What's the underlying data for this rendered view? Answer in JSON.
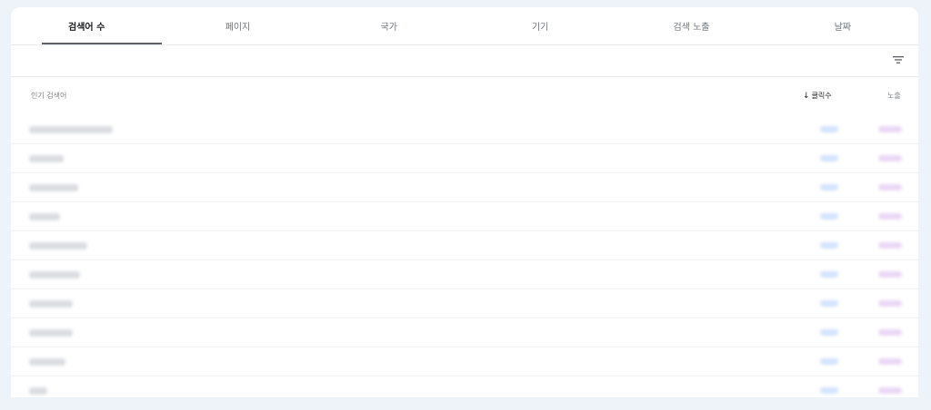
{
  "tabs": [
    {
      "label": "검색어 수",
      "active": true
    },
    {
      "label": "페이지",
      "active": false
    },
    {
      "label": "국가",
      "active": false
    },
    {
      "label": "기기",
      "active": false
    },
    {
      "label": "검색 노출",
      "active": false
    },
    {
      "label": "날짜",
      "active": false
    }
  ],
  "table": {
    "query_header": "인기 검색어",
    "clicks_header": "클릭수",
    "impressions_header": "노출",
    "sort_icon": "arrow-down-icon",
    "filter_icon": "filter-icon",
    "rows": [
      {
        "query": "",
        "clicks": "",
        "impressions": ""
      },
      {
        "query": "",
        "clicks": "",
        "impressions": ""
      },
      {
        "query": "",
        "clicks": "",
        "impressions": ""
      },
      {
        "query": "",
        "clicks": "",
        "impressions": ""
      },
      {
        "query": "",
        "clicks": "",
        "impressions": ""
      },
      {
        "query": "",
        "clicks": "",
        "impressions": ""
      },
      {
        "query": "",
        "clicks": "",
        "impressions": ""
      },
      {
        "query": "",
        "clicks": "",
        "impressions": ""
      },
      {
        "query": "",
        "clicks": "",
        "impressions": ""
      },
      {
        "query": "",
        "clicks": "",
        "impressions": ""
      }
    ]
  },
  "colors": {
    "background": "#eef2f9",
    "card": "#ffffff",
    "clicks_accent": "#4285f4",
    "impressions_accent": "#a142f4"
  }
}
